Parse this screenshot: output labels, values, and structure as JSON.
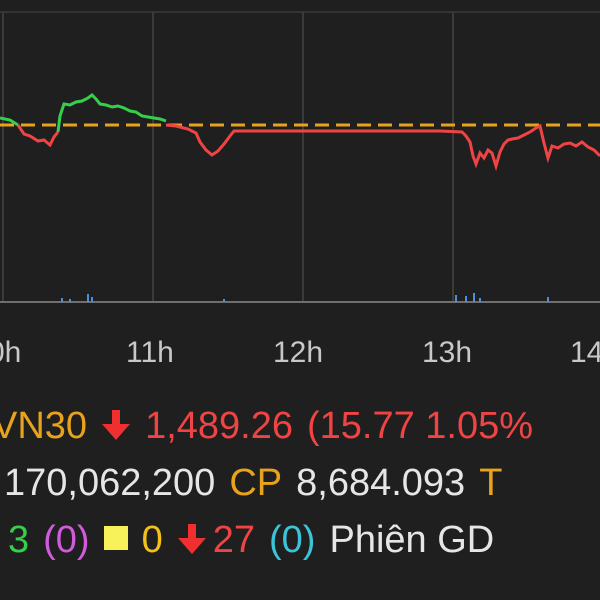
{
  "chart": {
    "time_labels": [
      "0h",
      "11h",
      "12h",
      "13h",
      "14"
    ],
    "reference_color": "#e9a21c",
    "up_color": "#34d04a",
    "down_color": "#f04444",
    "volume_color": "#4a90e2"
  },
  "index_row": {
    "index_name": "VN30",
    "index_value": "1,489.26",
    "change_text": "(15.77 1.05%",
    "arrow_icon": "arrow-down-icon"
  },
  "volume_row": {
    "volume": "170,062,200",
    "cp_label": "CP",
    "value": "8,684.093",
    "trailing_label": "T"
  },
  "breadth_row": {
    "advancing": "3",
    "ceiling": "(0)",
    "square_icon": "square-icon",
    "unchanged": "0",
    "arrow_icon": "arrow-down-icon",
    "declining": "27",
    "floor": "(0)",
    "session_label": "Phiên GD"
  }
}
